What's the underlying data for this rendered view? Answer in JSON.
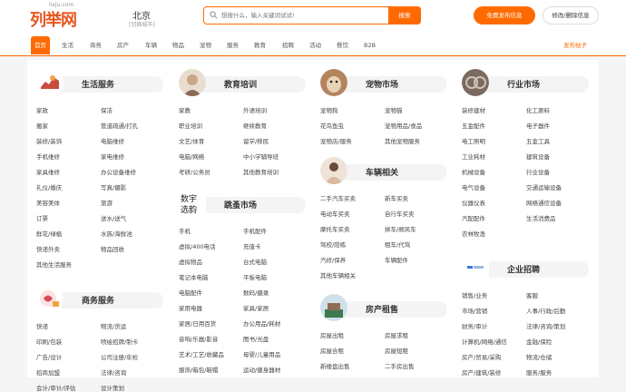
{
  "header": {
    "logo": "列举网",
    "logo_sub": "lieju.com",
    "city": "北京",
    "city_switch": "[切换城市]",
    "search_placeholder": "想搜什么，输入关键词试试!",
    "search_button": "搜索",
    "post_button": "免费发布信息",
    "edit_button": "修改/删除信息"
  },
  "nav": {
    "items": [
      "首页",
      "生活",
      "商务",
      "房产",
      "车辆",
      "物品",
      "宠物",
      "服务",
      "教育",
      "招聘",
      "活动",
      "餐饮",
      "B2B"
    ],
    "post_link": "发布帖子"
  },
  "sections": {
    "life": {
      "title": "生活服务",
      "links": [
        "家政",
        "保洁",
        "搬家",
        "管道疏通/打孔",
        "装修/装饰",
        "电脑维修",
        "手机维修",
        "家电维修",
        "家具维修",
        "办公设备维修",
        "礼仪/婚庆",
        "写真/摄影",
        "美容美体",
        "旅游",
        "订票",
        "送水/送气",
        "鲜花/绿植",
        "水族/海鲜池",
        "快递外卖",
        "物品回收",
        "其他生活服务"
      ]
    },
    "business": {
      "title": "商务服务",
      "links": [
        "快递",
        "物流/货运",
        "印刷/包装",
        "喷绘招牌/制卡",
        "广告/设计",
        "公司注册/年检",
        "招商加盟",
        "法律/咨询",
        "会计/审计/评估",
        "设计策划"
      ]
    },
    "edu": {
      "title": "教育培训",
      "links": [
        "家教",
        "外语培训",
        "职业培训",
        "继续教育",
        "文艺/体育",
        "留学/移民",
        "电脑/网络",
        "中小学辅导班",
        "考研/公务员",
        "其他教育培训"
      ]
    },
    "flea": {
      "title": "跳蚤市场",
      "links": [
        "手机",
        "手机配件",
        "虚拟/400电话",
        "充值卡",
        "虚拟物品",
        "台式电脑",
        "笔记本电脑",
        "平板电脑",
        "电脑配件",
        "数码/摄录",
        "家用电器",
        "家具/家居",
        "家居/日用百货",
        "办公用品/耗材",
        "音响/乐器/影音",
        "图书/光盘",
        "艺术/工艺/收藏品",
        "母婴/儿童用品",
        "服饰/箱包/鞋帽",
        "运动/健身器材"
      ]
    },
    "pet": {
      "title": "宠物市场",
      "links": [
        "宠物狗",
        "宠物猫",
        "花鸟鱼虫",
        "宠物用品/食品",
        "宠物店/服务",
        "其他宠物服务"
      ]
    },
    "car": {
      "title": "车辆相关",
      "links": [
        "二手汽车买卖",
        "新车买卖",
        "电动车买卖",
        "自行车买卖",
        "摩托车买卖",
        "拼车/顺风车",
        "驾校/陪练",
        "租车/代驾",
        "汽修/保养",
        "车辆配件",
        "其他车辆相关"
      ]
    },
    "house": {
      "title": "房产租售",
      "links": [
        "房屋出租",
        "房屋求租",
        "房屋合租",
        "房屋短租",
        "新楼盘出售",
        "二手房出售"
      ]
    },
    "industry": {
      "title": "行业市场",
      "links": [
        "装修建材",
        "化工原料",
        "五金配件",
        "电子器件",
        "电工照明",
        "五金工具",
        "工业耗材",
        "建筑设备",
        "机械设备",
        "行业设备",
        "电气设备",
        "交通运输设备",
        "仪器仪表",
        "网络通信设备",
        "汽配配件",
        "生活消费品",
        "农林牧渔"
      ]
    },
    "job": {
      "title": "企业招聘",
      "links": [
        "销售/业务",
        "客服",
        "市场/营销",
        "人事/行政/后勤",
        "财务/审计",
        "法律/咨询/策划",
        "计算机/网络/通信",
        "金融/保险",
        "房产/贸易/采购",
        "物流/仓储",
        "房产/建筑/装修",
        "服务/服务"
      ]
    }
  },
  "colors": {
    "accent": "#ff6a00",
    "logo": "#e8561f"
  }
}
